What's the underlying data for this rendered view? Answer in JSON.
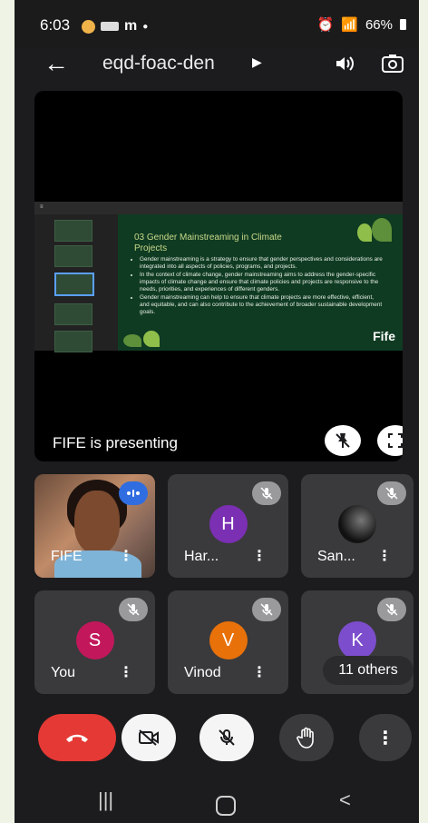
{
  "status_bar": {
    "time": "6:03",
    "battery": "66%"
  },
  "toolbar": {
    "meeting_code": "eqd-foac-den"
  },
  "stage": {
    "presenting_text": "FIFE is presenting",
    "slide": {
      "heading": "03 Gender Mainstreaming in Climate Projects",
      "bullets": [
        "Gender mainstreaming is a strategy to ensure that gender perspectives and considerations are integrated into all aspects of policies, programs, and projects.",
        "In the context of climate change, gender mainstreaming aims to address the gender-specific impacts of climate change and ensure that climate policies and projects are responsive to the needs, priorities, and experiences of different genders.",
        "Gender mainstreaming can help to ensure that climate projects are more effective, efficient, and equitable, and can also contribute to the achievement of broader sustainable development goals."
      ],
      "brand": "Fife"
    }
  },
  "participants": [
    {
      "name": "FIFE"
    },
    {
      "name": "Har...",
      "initial": "H",
      "color": "#7b2fb3"
    },
    {
      "name": "San..."
    },
    {
      "name": "You",
      "initial": "S",
      "color": "#c2185b"
    },
    {
      "name": "Vinod",
      "initial": "V",
      "color": "#e8710a"
    },
    {
      "initial": "K",
      "color": "#7c4dcc"
    }
  ],
  "others_label": "11 others",
  "colors": {
    "end_call": "#e53935",
    "background": "#1c1c1e"
  }
}
